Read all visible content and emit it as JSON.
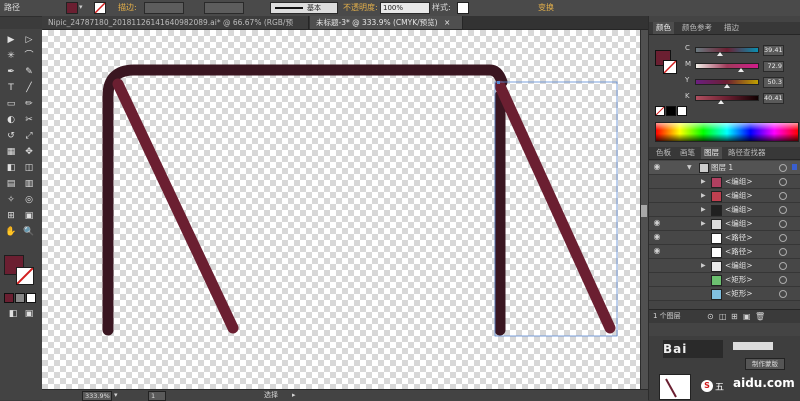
{
  "control_bar": {
    "object_type": "路径",
    "stroke_label": "描边:",
    "brush_label": "基本",
    "opacity_label": "不透明度:",
    "opacity_value": "100%",
    "style_label": "样式:",
    "transform_label": "变换",
    "fill_color": "#6b1f31",
    "stroke_color": "#ffffff"
  },
  "tabs": [
    {
      "label": "Nipic_24787180_20181126141640982089.ai* @ 66.67% (RGB/预览)"
    },
    {
      "label": "未标题-3* @ 333.9% (CMYK/预览)"
    }
  ],
  "tab_close": "×",
  "tools": {
    "fill_color": "#6b1f31",
    "glyphs": [
      "▶",
      "▷",
      "✳",
      "⌒",
      "✒",
      "✎",
      "T",
      "╱",
      "▭",
      "✏",
      "◐",
      "✂",
      "↺",
      "⤢",
      "▦",
      "✥",
      "◧",
      "◫",
      "▤",
      "▥",
      "✧",
      "◎",
      "⊞",
      "▣",
      "✋",
      "🔍"
    ]
  },
  "status": {
    "zoom": "333.9%",
    "page": "1",
    "selection_label": "选择"
  },
  "color_panel": {
    "tabs": [
      "颜色",
      "颜色参考",
      "描边"
    ],
    "channels": [
      {
        "label": "C",
        "value": "39.41",
        "fraction": 0.394,
        "gradient": [
          "#6b7a80",
          "#6b1f31",
          "#0a8fb0"
        ]
      },
      {
        "label": "M",
        "value": "72.9",
        "fraction": 0.729,
        "gradient": [
          "#f2efe8",
          "#a03a5a",
          "#d01c8b"
        ]
      },
      {
        "label": "Y",
        "value": "50.3",
        "fraction": 0.503,
        "gradient": [
          "#6b1f80",
          "#6b1f31",
          "#c0a000"
        ]
      },
      {
        "label": "K",
        "value": "40.41",
        "fraction": 0.404,
        "gradient": [
          "#b05060",
          "#6b1f31",
          "#100000"
        ]
      }
    ]
  },
  "layers_panel": {
    "tabs": [
      "色板",
      "画笔",
      "图层",
      "路径查找器"
    ],
    "active_tab": "图层",
    "layer_name": "图层 1",
    "rows": [
      {
        "name": "<编组>",
        "expand": true,
        "eye": false,
        "thumb": "#b04060"
      },
      {
        "name": "<编组>",
        "expand": true,
        "eye": false,
        "thumb": "#c04050"
      },
      {
        "name": "<编组>",
        "expand": true,
        "eye": false,
        "thumb": "#202020"
      },
      {
        "name": "<编组>",
        "expand": true,
        "eye": true,
        "thumb": "#dddddd"
      },
      {
        "name": "<路径>",
        "expand": false,
        "eye": true,
        "thumb": "#ffffff"
      },
      {
        "name": "<路径>",
        "expand": false,
        "eye": true,
        "thumb": "#ffffff"
      },
      {
        "name": "<编组>",
        "expand": true,
        "eye": false,
        "thumb": "#e8e8e8"
      },
      {
        "name": "<矩形>",
        "expand": false,
        "eye": false,
        "thumb": "#6cc070"
      },
      {
        "name": "<矩形>",
        "expand": false,
        "eye": false,
        "thumb": "#80c0e0"
      }
    ],
    "footer_label": "1 个图层",
    "make_template_label": "制作蒙版"
  },
  "watermark": {
    "text": "aidu.com",
    "brand": "Bai"
  },
  "ime": {
    "label": "五"
  }
}
